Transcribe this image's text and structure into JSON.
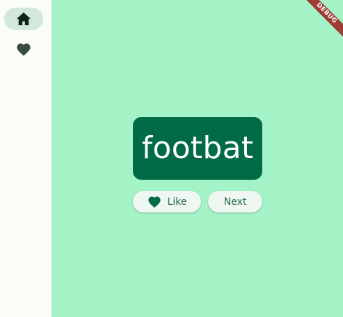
{
  "navigation_rail": {
    "items": [
      {
        "icon": "home-icon",
        "selected": true
      },
      {
        "icon": "heart-icon",
        "selected": false
      }
    ]
  },
  "main": {
    "word_card": {
      "text": "footbat"
    },
    "like_button": {
      "label": "Like",
      "icon": "heart-icon"
    },
    "next_button": {
      "label": "Next"
    }
  },
  "debug_banner": {
    "label": "DEBUG"
  },
  "colors": {
    "main_background": "#a3f3c6",
    "rail_background": "#f9fcf7",
    "card_background": "#006b44",
    "button_text": "#1d6b47",
    "ribbon": "#9e3d36"
  }
}
